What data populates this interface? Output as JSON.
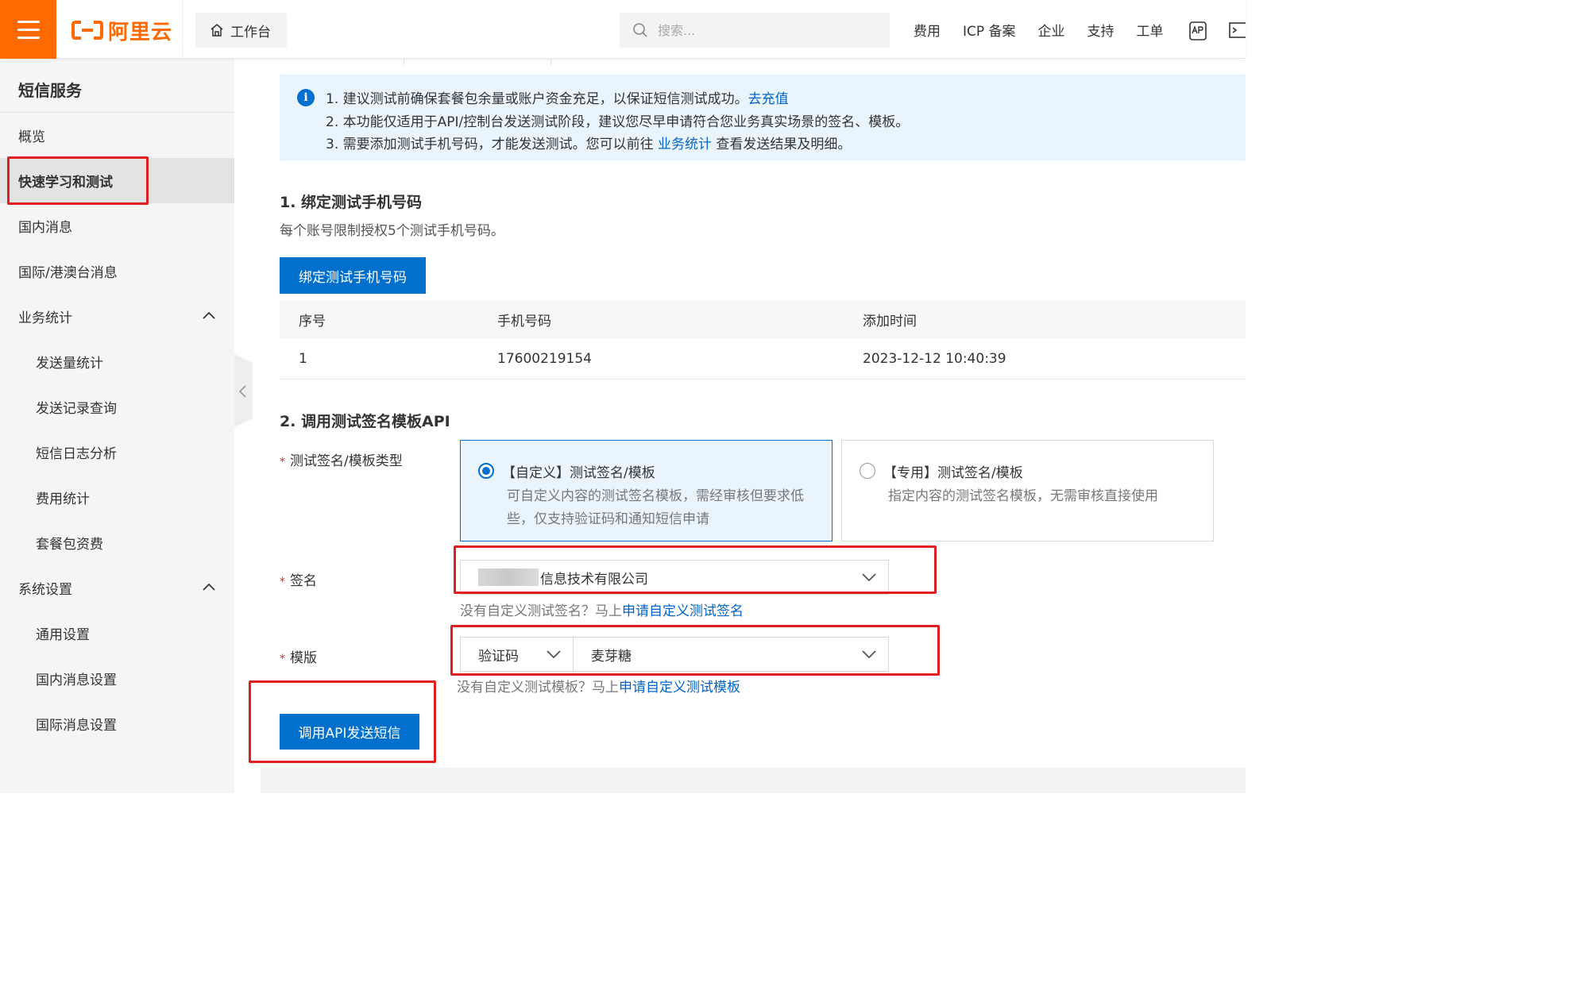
{
  "topbar": {
    "logo_text": "阿里云",
    "workbench_label": "工作台",
    "search_placeholder": "搜索...",
    "nav": [
      "费用",
      "ICP 备案",
      "企业",
      "支持",
      "工单"
    ]
  },
  "sidebar": {
    "title": "短信服务",
    "items": [
      {
        "label": "概览"
      },
      {
        "label": "快速学习和测试"
      },
      {
        "label": "国内消息"
      },
      {
        "label": "国际/港澳台消息"
      },
      {
        "label": "业务统计"
      },
      {
        "label": "发送量统计"
      },
      {
        "label": "发送记录查询"
      },
      {
        "label": "短信日志分析"
      },
      {
        "label": "费用统计"
      },
      {
        "label": "套餐包资费"
      },
      {
        "label": "系统设置"
      },
      {
        "label": "通用设置"
      },
      {
        "label": "国内消息设置"
      },
      {
        "label": "国际消息设置"
      }
    ]
  },
  "notice": {
    "line1_text": "1. 建议测试前确保套餐包余量或账户资金充足，以保证短信测试成功。",
    "line1_link": "去充值",
    "line2_text": "2. 本功能仅适用于API/控制台发送测试阶段，建议您尽早申请符合您业务真实场景的签名、模板。",
    "line3_text": "3. 需要添加测试手机号码，才能发送测试。您可以前往 ",
    "line3_link": "业务统计",
    "line3_tail": " 查看发送结果及明细。"
  },
  "section1": {
    "title": "1. 绑定测试手机号码",
    "desc": "每个账号限制授权5个测试手机号码。",
    "bind_button": "绑定测试手机号码",
    "columns": [
      "序号",
      "手机号码",
      "添加时间"
    ],
    "rows": [
      {
        "index": "1",
        "phone": "17600219154",
        "time": "2023-12-12 10:40:39"
      }
    ]
  },
  "section2": {
    "title": "2. 调用测试签名模板API",
    "type_label": "测试签名/模板类型",
    "required_mark": "*",
    "option_custom_title": "【自定义】测试签名/模板",
    "option_custom_desc_1": "可自定义内容的测试签名模板，需经审核但要求低",
    "option_custom_desc_2": "些，仅支持验证码和通知短信申请",
    "option_special_title": "【专用】测试签名/模板",
    "option_special_desc": "指定内容的测试签名模板，无需审核直接使用",
    "sign_label": "签名",
    "sign_value": "信息技术有限公司",
    "sign_hint": "没有自定义测试签名？马上",
    "sign_hint_link": "申请自定义测试签名",
    "template_label": "模版",
    "template_type_value": "验证码",
    "template_value": "麦芽糖",
    "template_hint": "没有自定义测试模板？马上",
    "template_hint_link": "申请自定义测试模板",
    "send_button": "调用API发送短信"
  },
  "colors": {
    "brand_orange": "#ff6a00",
    "primary_blue": "#0070cc",
    "highlight_red": "#e02020"
  }
}
